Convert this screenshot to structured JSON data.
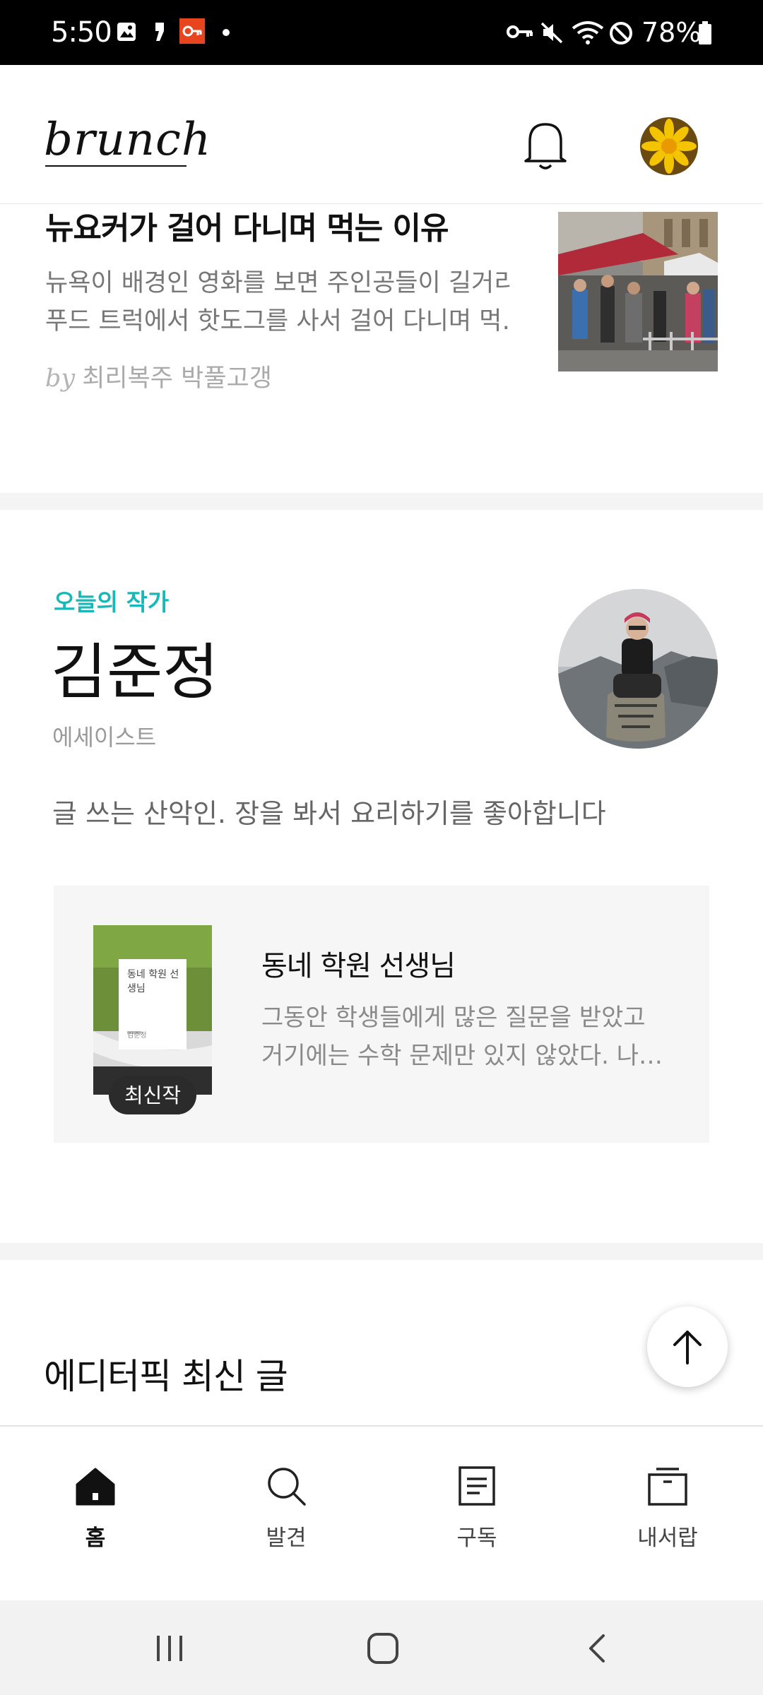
{
  "status_bar": {
    "time": "5:50",
    "battery": "78%",
    "icons": [
      "gallery-icon",
      "quote-icon",
      "key-app-icon",
      "dot-icon",
      "vpn-key-icon",
      "mute-icon",
      "wifi-icon",
      "do-not-disturb-icon",
      "battery-icon"
    ]
  },
  "header": {
    "logo": "brunch",
    "icons": [
      "bell-icon",
      "profile-avatar"
    ]
  },
  "article": {
    "title": "뉴요커가 걸어 다니며 먹는 이유",
    "snippet_line1": "뉴욕이 배경인 영화를 보면 주인공들이 길거리",
    "snippet_line2": "푸드 트럭에서 핫도그를 사서 걸어 다니며 먹…",
    "by": "by",
    "author": "최리복주 박풀고갱"
  },
  "writer": {
    "label": "오늘의 작가",
    "name": "김준정",
    "role": "에세이스트",
    "intro": "글 쓰는 산악인. 장을 봐서 요리하기를 좋아합니다"
  },
  "book": {
    "badge": "최신작",
    "title": "동네 학원 선생님",
    "snippet_line1": "그동안 학생들에게 많은 질문을 받았고",
    "snippet_line2": "거기에는 수학 문제만 있지 않았다. 나…",
    "cover_title": "동네 학원 선생님",
    "cover_author": "김준정"
  },
  "section": {
    "title": "에디터픽 최신 글"
  },
  "scroll_top": {
    "icon": "arrow-up-icon"
  },
  "nav": {
    "items": [
      {
        "label": "홈",
        "icon": "home-icon",
        "active": true
      },
      {
        "label": "발견",
        "icon": "search-icon",
        "active": false
      },
      {
        "label": "구독",
        "icon": "document-icon",
        "active": false
      },
      {
        "label": "내서랍",
        "icon": "drawer-icon",
        "active": false
      }
    ]
  },
  "system_nav": {
    "icons": [
      "recents-icon",
      "home-circle-icon",
      "back-icon"
    ]
  }
}
